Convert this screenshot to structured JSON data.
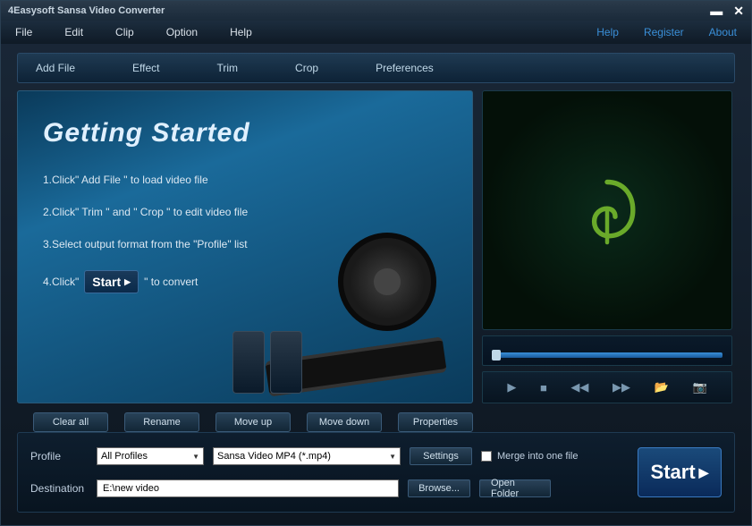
{
  "titlebar": {
    "title": "4Easysoft Sansa Video Converter"
  },
  "menubar": {
    "items": [
      "File",
      "Edit",
      "Clip",
      "Option",
      "Help"
    ],
    "right": [
      "Help",
      "Register",
      "About"
    ]
  },
  "toolbar": {
    "items": [
      "Add File",
      "Effect",
      "Trim",
      "Crop",
      "Preferences"
    ]
  },
  "getting_started": {
    "title": "Getting Started",
    "step1": "1.Click\" Add File \" to load video file",
    "step2": "2.Click\" Trim \" and \" Crop \" to edit video file",
    "step3": "3.Select output format from the \"Profile\" list",
    "step4_prefix": "4.Click\"",
    "step4_button": "Start",
    "step4_suffix": "\" to convert"
  },
  "list_buttons": [
    "Clear all",
    "Rename",
    "Move up",
    "Move down",
    "Properties"
  ],
  "bottom": {
    "profile_label": "Profile",
    "profile_group": "All Profiles",
    "profile_format": "Sansa Video MP4 (*.mp4)",
    "settings": "Settings",
    "merge": "Merge into one file",
    "destination_label": "Destination",
    "destination_value": "E:\\new video",
    "browse": "Browse...",
    "open_folder": "Open Folder",
    "start": "Start"
  }
}
